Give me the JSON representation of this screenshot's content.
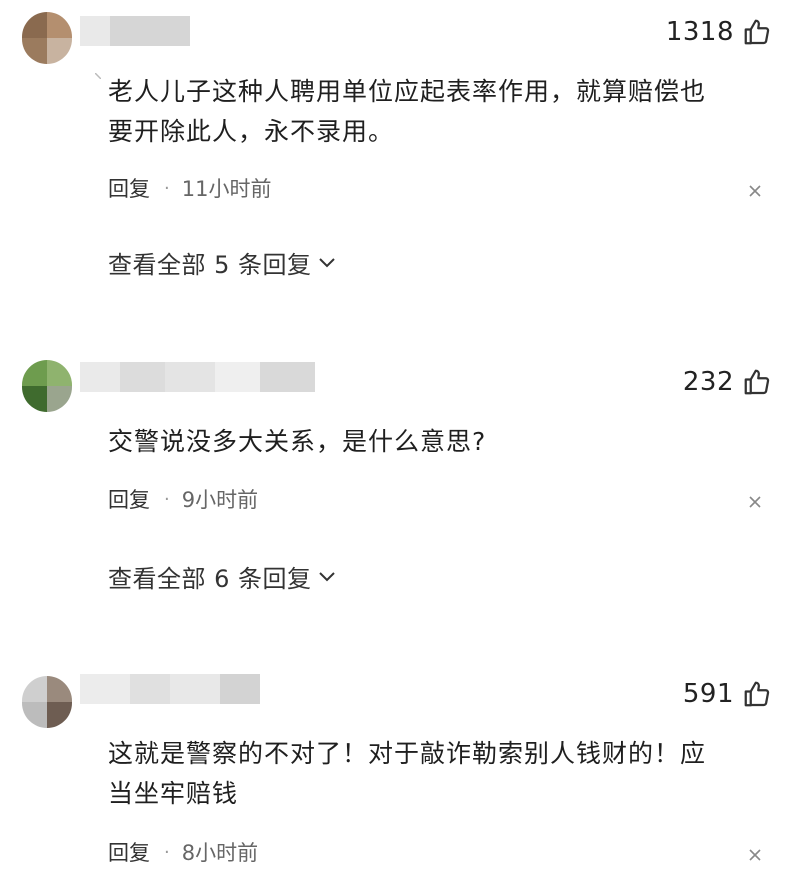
{
  "comments": [
    {
      "likes": "1318",
      "text": "老人儿子这种人聘用单位应起表率作用，就算赔偿也\n要开除此人，永不录用。",
      "reply_label": "回复",
      "dot": "·",
      "time": "11小时前",
      "view_replies": "查看全部 5 条回复"
    },
    {
      "likes": "232",
      "text": "交警说没多大关系，是什么意思?",
      "reply_label": "回复",
      "dot": "·",
      "time": "9小时前",
      "view_replies": "查看全部 6 条回复"
    },
    {
      "likes": "591",
      "text": "这就是警察的不对了！对于敲诈勒索别人钱财的！应\n当坐牢赔钱",
      "reply_label": "回复",
      "dot": "·",
      "time": "8小时前"
    }
  ],
  "icons": {
    "like": "thumbs-up-icon",
    "close": "close-icon",
    "expand": "chevron-down-icon"
  },
  "colors": {
    "text": "#1f1f1f",
    "meta": "#666666",
    "icon": "#333333"
  }
}
